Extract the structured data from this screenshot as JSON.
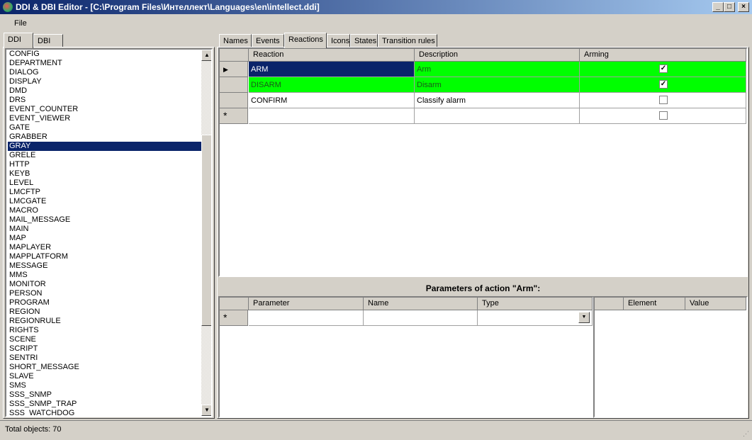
{
  "window": {
    "title": "DDI & DBI Editor - [C:\\Program Files\\Интеллект\\Languages\\en\\intellect.ddi]",
    "min": "_",
    "max": "□",
    "close": "×"
  },
  "menu": {
    "file": "File"
  },
  "left_tabs": [
    "DDI",
    "DBI"
  ],
  "objects": [
    "CONFIG",
    "DEPARTMENT",
    "DIALOG",
    "DISPLAY",
    "DMD",
    "DRS",
    "EVENT_COUNTER",
    "EVENT_VIEWER",
    "GATE",
    "GRABBER",
    "GRAY",
    "GRELE",
    "HTTP",
    "KEYB",
    "LEVEL",
    "LMCFTP",
    "LMCGATE",
    "MACRO",
    "MAIL_MESSAGE",
    "MAIN",
    "MAP",
    "MAPLAYER",
    "MAPPLATFORM",
    "MESSAGE",
    "MMS",
    "MONITOR",
    "PERSON",
    "PROGRAM",
    "REGION",
    "REGIONRULE",
    "RIGHTS",
    "SCENE",
    "SCRIPT",
    "SENTRI",
    "SHORT_MESSAGE",
    "SLAVE",
    "SMS",
    "SSS_SNMP",
    "SSS_SNMP_TRAP",
    "SSS_WATCHDOG"
  ],
  "selected_object": "GRAY",
  "right_tabs": [
    "Names",
    "Events",
    "Reactions",
    "Icons",
    "States",
    "Transition rules"
  ],
  "active_right_tab": "Reactions",
  "reactions": {
    "headers": [
      "Reaction",
      "Description",
      "Arming"
    ],
    "rows": [
      {
        "reaction": "ARM",
        "description": "Arm",
        "arming": true,
        "highlight": "#00ff00"
      },
      {
        "reaction": "DISARM",
        "description": "Disarm",
        "arming": true,
        "highlight": "#00ff00"
      },
      {
        "reaction": "CONFIRM",
        "description": "Classify alarm",
        "arming": false,
        "highlight": ""
      }
    ],
    "new_row_marker": "*",
    "current_marker": "▶"
  },
  "params": {
    "title": "Parameters of action \"Arm\":",
    "headers": [
      "Parameter",
      "Name",
      "Type"
    ],
    "new_row_marker": "*"
  },
  "elements": {
    "headers": [
      "Element",
      "Value"
    ]
  },
  "status": {
    "text": "Total objects: 70"
  }
}
